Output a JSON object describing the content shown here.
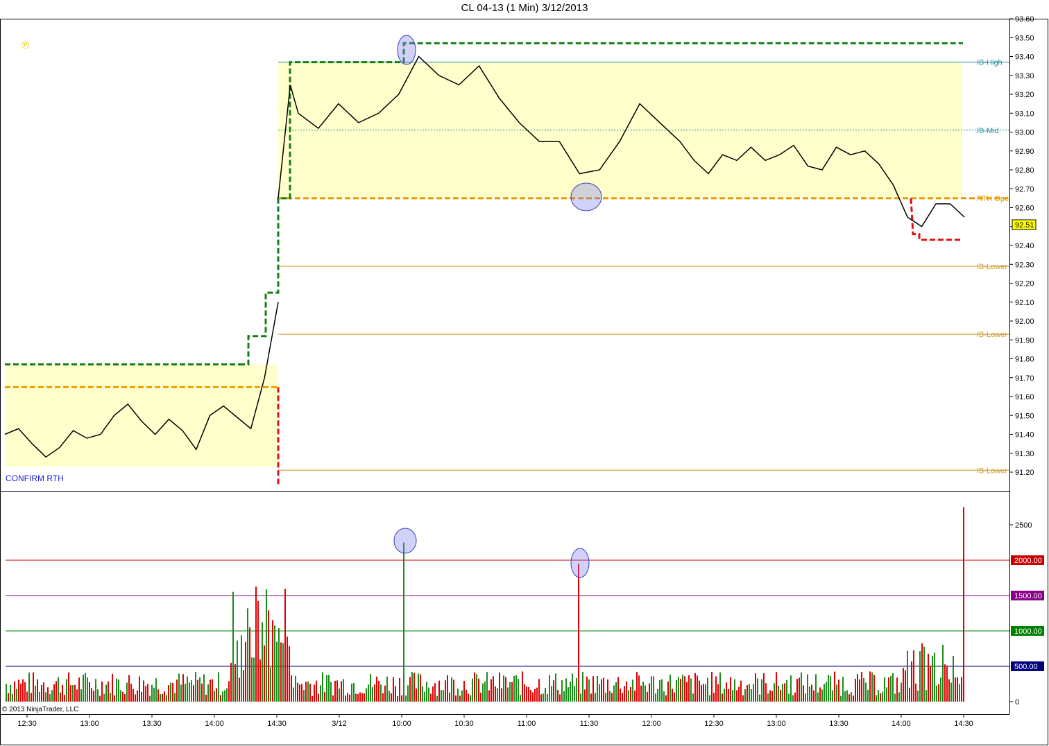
{
  "title": "CL 04-13 (1 Min)  3/12/2013",
  "confirm_label": "CONFIRM RTH",
  "copyright": "© 2013 NinjaTrader, LLC",
  "p_marker": "℗",
  "chart_data": [
    {
      "type": "line",
      "title": "CL 04-13 (1 Min)  3/12/2013",
      "xlabel": "",
      "ylabel": "",
      "x_tick_labels": [
        "12:30",
        "13:00",
        "13:30",
        "14:00",
        "14:30",
        "3/12",
        "10:00",
        "10:30",
        "11:00",
        "11:30",
        "12:00",
        "12:30",
        "13:00",
        "13:30",
        "14:00",
        "14:30"
      ],
      "ylim": [
        91.13,
        93.63
      ],
      "y_ticks": [
        91.2,
        91.3,
        91.4,
        91.5,
        91.6,
        91.7,
        91.8,
        91.9,
        92.0,
        92.1,
        92.2,
        92.3,
        92.4,
        92.5,
        92.6,
        92.7,
        92.8,
        92.9,
        93.0,
        93.1,
        93.2,
        93.3,
        93.4,
        93.5,
        93.6
      ],
      "last_price": "92.51",
      "series": [
        {
          "name": "",
          "session": "prior",
          "color": "#000000",
          "x": [
            0,
            5,
            10,
            15,
            20,
            25,
            30,
            35,
            40,
            45,
            50,
            55,
            60,
            65,
            70,
            75,
            80,
            85,
            90,
            95,
            100
          ],
          "values": [
            91.4,
            91.43,
            91.35,
            91.28,
            91.33,
            91.42,
            91.38,
            91.4,
            91.5,
            91.56,
            91.47,
            91.4,
            91.48,
            91.42,
            91.32,
            91.5,
            91.55,
            91.49,
            91.43,
            91.7,
            92.1
          ]
        },
        {
          "name": "",
          "session": "rth",
          "color": "#000000",
          "x": [
            0,
            3,
            5,
            10,
            15,
            20,
            25,
            30,
            35,
            40,
            45,
            50,
            55,
            60,
            65,
            70,
            75,
            80,
            85,
            90,
            95,
            100
          ],
          "values": [
            92.65,
            93.25,
            93.1,
            93.02,
            93.15,
            93.05,
            93.1,
            93.2,
            93.4,
            93.3,
            93.25,
            93.35,
            93.18,
            93.05,
            92.95,
            92.95,
            92.78,
            92.8,
            92.95,
            93.15,
            93.05,
            92.95
          ]
        },
        {
          "name": "",
          "session": "rth2",
          "color": "#000000",
          "x": [
            0,
            5,
            10,
            15,
            20,
            25,
            30,
            35,
            40,
            45,
            50,
            55,
            60,
            65,
            70,
            75,
            80,
            85,
            90,
            95,
            100
          ],
          "values": [
            92.95,
            92.85,
            92.78,
            92.88,
            92.85,
            92.92,
            92.85,
            92.88,
            92.93,
            92.82,
            92.8,
            92.92,
            92.88,
            92.9,
            92.83,
            92.72,
            92.55,
            92.5,
            92.62,
            92.62,
            92.55
          ]
        }
      ],
      "levels": [
        {
          "label": "IB-High",
          "value": 93.37,
          "color": "#1f8c9e"
        },
        {
          "label": "IB-Mid",
          "value": 93.01,
          "color": "#1f8c9e"
        },
        {
          "label": "RTH Ope",
          "value": 92.65,
          "color": "#e89a00"
        },
        {
          "label": "IB-Lower",
          "value": 92.29,
          "color": "#d29a2a"
        },
        {
          "label": "IB-Lower",
          "value": 91.93,
          "color": "#d29a2a"
        },
        {
          "label": "IB-Lower",
          "value": 91.21,
          "color": "#d29a2a"
        }
      ],
      "prior_range": {
        "high": 91.77,
        "low": 91.23,
        "mid": 91.65
      },
      "session_high_step": [
        91.77,
        91.92,
        92.15,
        92.65,
        93.37,
        93.47
      ],
      "session_low_step": [
        92.65,
        92.46,
        92.43
      ]
    },
    {
      "type": "bar",
      "title": "",
      "ylim": [
        0,
        3000
      ],
      "y_ticks": [
        0,
        2500
      ],
      "levels": [
        {
          "label": "2000.00",
          "value": 2000,
          "color": "#c80000"
        },
        {
          "label": "1500.00",
          "value": 1500,
          "color": "#8a008a"
        },
        {
          "label": "1000.00",
          "value": 1000,
          "color": "#008000"
        },
        {
          "label": "500.00",
          "value": 500,
          "color": "#000080"
        }
      ],
      "up_color": "#1a8c1a",
      "down_color": "#e00000",
      "annotated_peaks": [
        2250,
        1950
      ],
      "final_bar": 2750
    }
  ]
}
